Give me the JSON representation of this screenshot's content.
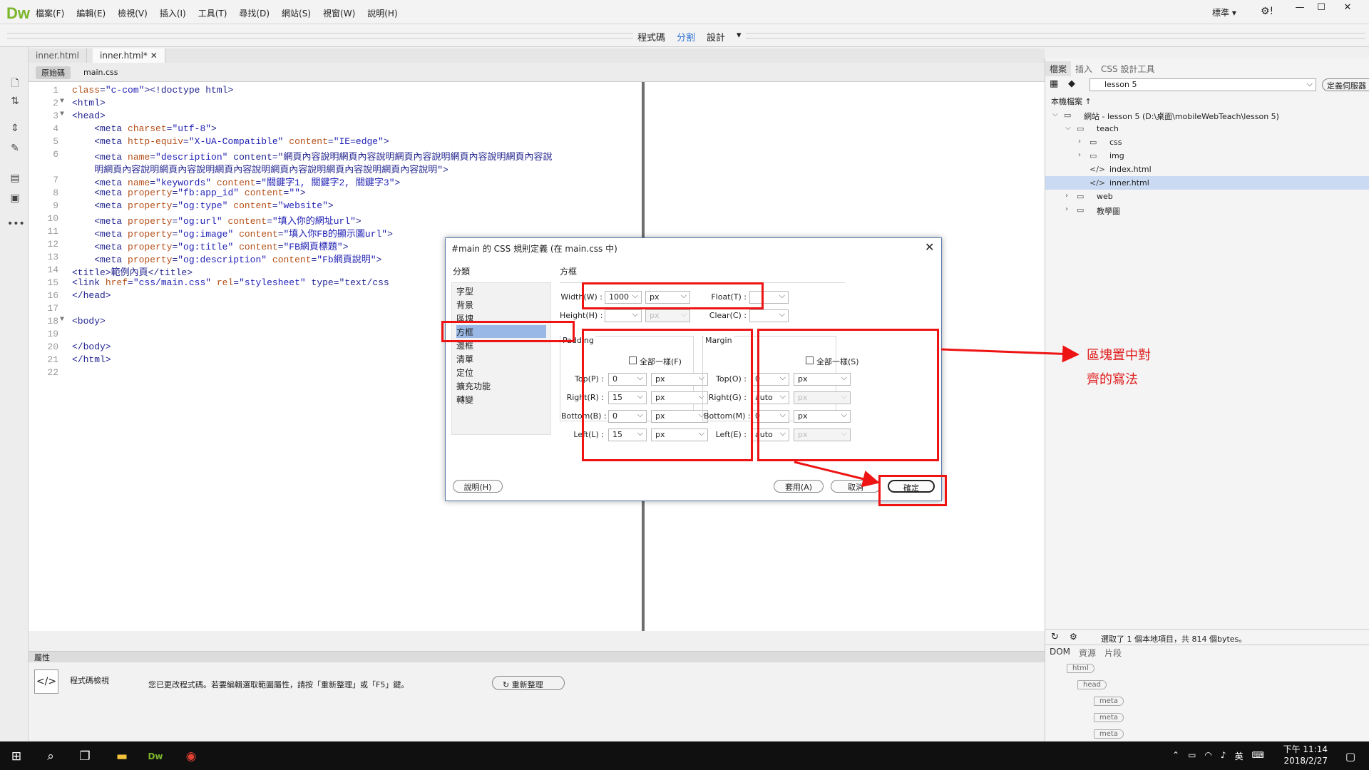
{
  "app": {
    "logo": "Dw",
    "menus": [
      "檔案(F)",
      "編輯(E)",
      "檢視(V)",
      "插入(I)",
      "工具(T)",
      "尋找(D)",
      "網站(S)",
      "視窗(W)",
      "說明(H)"
    ],
    "workspace": "標準",
    "view_buttons": [
      "程式碼",
      "分割",
      "設計"
    ],
    "active_view": "分割"
  },
  "doc_tabs": [
    "inner.html",
    "inner.html*"
  ],
  "source_bar": {
    "source_label": "原始碼",
    "related_file": "main.css"
  },
  "code_lines": [
    {
      "n": "1",
      "fold": "",
      "text": "<!doctype html>"
    },
    {
      "n": "2",
      "fold": "▼",
      "text": "<html>"
    },
    {
      "n": "3",
      "fold": "▼",
      "text": "<head>"
    },
    {
      "n": "4",
      "fold": "",
      "text": "    <meta charset=\"utf-8\">"
    },
    {
      "n": "5",
      "fold": "",
      "text": "    <meta http-equiv=\"X-UA-Compatible\" content=\"IE=edge\">"
    },
    {
      "n": "6",
      "fold": "",
      "text": "    <meta name=\"description\" content=\"網頁內容說明網頁內容說明網頁內容說明網頁內容說明網頁內容說"
    },
    {
      "n": "",
      "fold": "",
      "text": "    明網頁內容說明網頁內容說明網頁內容說明網頁內容說明網頁內容說明網頁內容說明\">"
    },
    {
      "n": "7",
      "fold": "",
      "text": "    <meta name=\"keywords\" content=\"關鍵字1, 關鍵字2, 關鍵字3\">"
    },
    {
      "n": "8",
      "fold": "",
      "text": "    <meta property=\"fb:app_id\" content=\"\">"
    },
    {
      "n": "9",
      "fold": "",
      "text": "    <meta property=\"og:type\" content=\"website\">"
    },
    {
      "n": "10",
      "fold": "",
      "text": "    <meta property=\"og:url\" content=\"填入你的網址url\">"
    },
    {
      "n": "11",
      "fold": "",
      "text": "    <meta property=\"og:image\" content=\"填入你FB的顯示圖url\">"
    },
    {
      "n": "12",
      "fold": "",
      "text": "    <meta property=\"og:title\" content=\"FB網頁標題\">"
    },
    {
      "n": "13",
      "fold": "",
      "text": "    <meta property=\"og:description\" content=\"Fb網頁說明\">"
    },
    {
      "n": "14",
      "fold": "",
      "text": "<title>範例內頁</title>"
    },
    {
      "n": "15",
      "fold": "",
      "text": "<link href=\"css/main.css\" rel=\"stylesheet\" type=\"text/css"
    },
    {
      "n": "16",
      "fold": "",
      "text": "</head>"
    },
    {
      "n": "17",
      "fold": "",
      "text": ""
    },
    {
      "n": "18",
      "fold": "▼",
      "text": "<body>"
    },
    {
      "n": "19",
      "fold": "",
      "text": ""
    },
    {
      "n": "20",
      "fold": "",
      "text": "</body>"
    },
    {
      "n": "21",
      "fold": "",
      "text": "</html>"
    },
    {
      "n": "22",
      "fold": "",
      "text": ""
    }
  ],
  "properties": {
    "header": "屬性",
    "mode": "程式碼檢視",
    "message": "您已更改程式碼。若要編輯選取範圍屬性，請按「重新整理」或「F5」鍵。",
    "refresh": "重新整理"
  },
  "files_panel": {
    "tabs": [
      "檔案",
      "插入",
      "CSS 設計工具"
    ],
    "site": "lesson 5",
    "define_server": "定義伺服器",
    "local_files": "本機檔案 ↑",
    "tree": [
      {
        "label": "網站 - lesson 5 (D:\\桌面\\mobileWebTeach\\lesson 5)",
        "arrow": "⌵",
        "icon": "▭",
        "sel": false
      },
      {
        "label": "teach",
        "arrow": "⌵",
        "icon": "▭",
        "sel": false
      },
      {
        "label": "css",
        "arrow": "›",
        "icon": "▭",
        "sel": false
      },
      {
        "label": "img",
        "arrow": "›",
        "icon": "▭",
        "sel": false
      },
      {
        "label": "index.html",
        "arrow": "",
        "icon": "</>",
        "sel": false
      },
      {
        "label": "inner.html",
        "arrow": "",
        "icon": "</>",
        "sel": true
      },
      {
        "label": "web",
        "arrow": "›",
        "icon": "▭",
        "sel": false
      },
      {
        "label": "教學圖",
        "arrow": "›",
        "icon": "▭",
        "sel": false
      }
    ],
    "status": "選取了 1 個本地項目，共 814 個bytes。",
    "dom_tabs": [
      "DOM",
      "資源",
      "片段"
    ],
    "dom_nodes": [
      "html",
      "head",
      "meta",
      "meta",
      "meta"
    ]
  },
  "dialog": {
    "title": "#main 的 CSS 規則定義 (在 main.css 中)",
    "category_label": "分類",
    "categories": [
      "字型",
      "背景",
      "區塊",
      "方框",
      "邊框",
      "清單",
      "定位",
      "擴充功能",
      "轉變"
    ],
    "selected_category": "方框",
    "section": "方框",
    "width_label": "Width(W) :",
    "width_value": "1000",
    "width_unit": "px",
    "height_label": "Height(H) :",
    "height_unit": "px",
    "float_label": "Float(T) :",
    "clear_label": "Clear(C) :",
    "padding_title": "Padding",
    "margin_title": "Margin",
    "padding_same": "全部一樣(F)",
    "margin_same": "全部一樣(S)",
    "padding": [
      {
        "label": "Top(P) :",
        "value": "0",
        "unit": "px"
      },
      {
        "label": "Right(R) :",
        "value": "15",
        "unit": "px"
      },
      {
        "label": "Bottom(B) :",
        "value": "0",
        "unit": "px"
      },
      {
        "label": "Left(L) :",
        "value": "15",
        "unit": "px"
      }
    ],
    "margin": [
      {
        "label": "Top(O) :",
        "value": "0",
        "unit": "px",
        "dis": false
      },
      {
        "label": "Right(G) :",
        "value": "auto",
        "unit": "px",
        "dis": true
      },
      {
        "label": "Bottom(M) :",
        "value": "0",
        "unit": "px",
        "dis": false
      },
      {
        "label": "Left(E) :",
        "value": "auto",
        "unit": "px",
        "dis": true
      }
    ],
    "help": "說明(H)",
    "apply": "套用(A)",
    "cancel": "取消",
    "ok": "確定"
  },
  "annotation": [
    "區塊置中對",
    "齊的寫法"
  ],
  "taskbar": {
    "time": "下午 11:14",
    "date": "2018/2/27",
    "ime": "英"
  },
  "colors": {
    "highlight_red": "#ee1414",
    "dw_green": "#7bb52b",
    "view_active": "#2b6fd6"
  }
}
